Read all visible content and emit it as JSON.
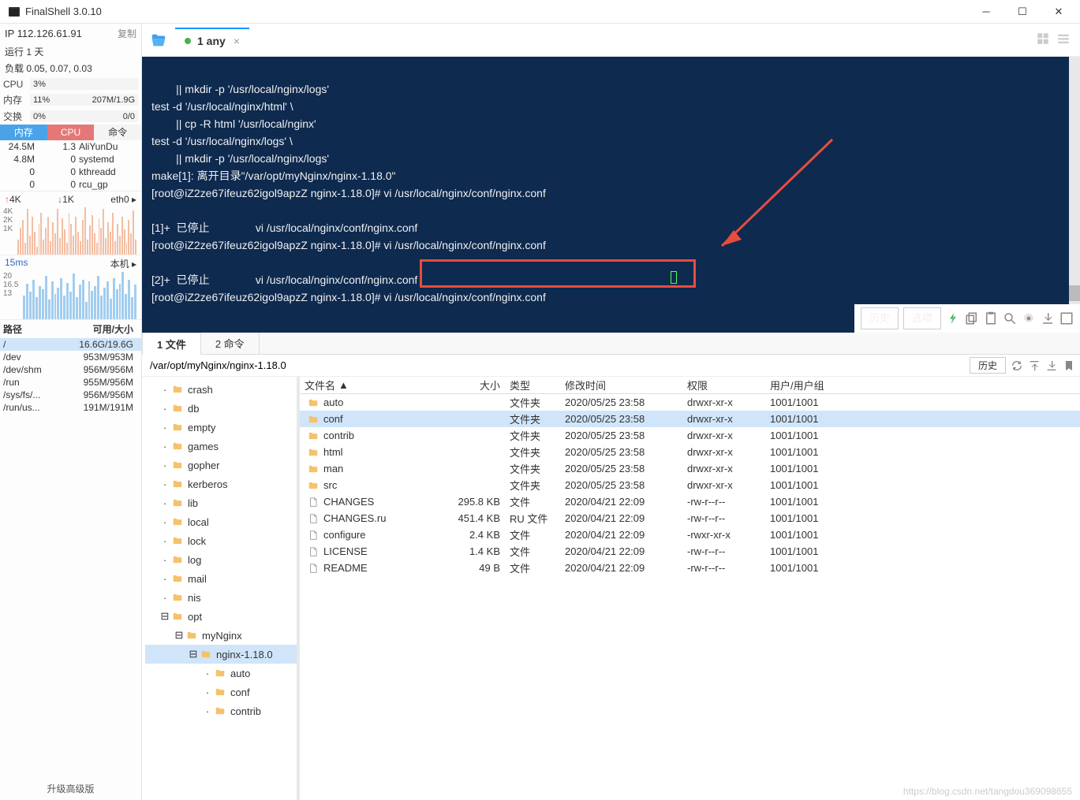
{
  "window": {
    "title": "FinalShell 3.0.10"
  },
  "sidebar": {
    "ip": "IP 112.126.61.91",
    "copy_label": "复制",
    "uptime": "运行 1 天",
    "load": "负载 0.05, 0.07, 0.03",
    "cpu_label": "CPU",
    "cpu_val": "3%",
    "mem_label": "内存",
    "mem_val": "11%",
    "mem_detail": "207M/1.9G",
    "swap_label": "交换",
    "swap_val": "0%",
    "swap_detail": "0/0",
    "tabs": {
      "mem": "内存",
      "cpu": "CPU",
      "cmd": "命令"
    },
    "procs": [
      {
        "mem": "24.5M",
        "cpu": "1.3",
        "name": "AliYunDu"
      },
      {
        "mem": "4.8M",
        "cpu": "0",
        "name": "systemd"
      },
      {
        "mem": "0",
        "cpu": "0",
        "name": "kthreadd"
      },
      {
        "mem": "0",
        "cpu": "0",
        "name": "rcu_gp"
      }
    ],
    "net_up": "4K",
    "net_dn": "1K",
    "net_if": "eth0",
    "net_ticks": [
      "4K",
      "2K",
      "1K"
    ],
    "ping": "15ms",
    "ping_label": "本机",
    "ping_ticks": [
      "20",
      "16.5",
      "13"
    ],
    "disk_hdr_path": "路径",
    "disk_hdr_usage": "可用/大小",
    "disks": [
      {
        "path": "/",
        "usage": "16.6G/19.6G",
        "sel": true
      },
      {
        "path": "/dev",
        "usage": "953M/953M"
      },
      {
        "path": "/dev/shm",
        "usage": "956M/956M"
      },
      {
        "path": "/run",
        "usage": "955M/956M"
      },
      {
        "path": "/sys/fs/...",
        "usage": "956M/956M"
      },
      {
        "path": "/run/us...",
        "usage": "191M/191M"
      }
    ],
    "upgrade": "升级高级版"
  },
  "tab": {
    "label": "1 any"
  },
  "terminal_lines": [
    "        || mkdir -p '/usr/local/nginx/logs'",
    "test -d '/usr/local/nginx/html' \\",
    "        || cp -R html '/usr/local/nginx'",
    "test -d '/usr/local/nginx/logs' \\",
    "        || mkdir -p '/usr/local/nginx/logs'",
    "make[1]: 离开目录\"/var/opt/myNginx/nginx-1.18.0\"",
    "[root@iZ2ze67ifeuz62igol9apzZ nginx-1.18.0]# vi /usr/local/nginx/conf/nginx.conf",
    "",
    "[1]+  已停止               vi /usr/local/nginx/conf/nginx.conf",
    "[root@iZ2ze67ifeuz62igol9apzZ nginx-1.18.0]# vi /usr/local/nginx/conf/nginx.conf",
    "",
    "[2]+  已停止               vi /usr/local/nginx/conf/nginx.conf",
    "[root@iZ2ze67ifeuz62igol9apzZ nginx-1.18.0]# vi /usr/local/nginx/conf/nginx.conf"
  ],
  "term_toolbar": {
    "history": "历史",
    "options": "选项"
  },
  "filetabs": {
    "files": "1 文件",
    "cmds": "2 命令"
  },
  "path_value": "/var/opt/myNginx/nginx-1.18.0",
  "path_history": "历史",
  "tree": [
    {
      "depth": 1,
      "name": "crash"
    },
    {
      "depth": 1,
      "name": "db"
    },
    {
      "depth": 1,
      "name": "empty"
    },
    {
      "depth": 1,
      "name": "games"
    },
    {
      "depth": 1,
      "name": "gopher"
    },
    {
      "depth": 1,
      "name": "kerberos"
    },
    {
      "depth": 1,
      "name": "lib"
    },
    {
      "depth": 1,
      "name": "local"
    },
    {
      "depth": 1,
      "name": "lock"
    },
    {
      "depth": 1,
      "name": "log"
    },
    {
      "depth": 1,
      "name": "mail"
    },
    {
      "depth": 1,
      "name": "nis"
    },
    {
      "depth": 1,
      "name": "opt",
      "exp": true
    },
    {
      "depth": 2,
      "name": "myNginx",
      "exp": true
    },
    {
      "depth": 3,
      "name": "nginx-1.18.0",
      "exp": true,
      "sel": true
    },
    {
      "depth": 4,
      "name": "auto"
    },
    {
      "depth": 4,
      "name": "conf"
    },
    {
      "depth": 4,
      "name": "contrib"
    }
  ],
  "file_hdr": {
    "name": "文件名",
    "size": "大小",
    "type": "类型",
    "time": "修改时间",
    "perm": "权限",
    "user": "用户/用户组"
  },
  "files": [
    {
      "icon": "folder",
      "name": "auto",
      "size": "",
      "type": "文件夹",
      "time": "2020/05/25 23:58",
      "perm": "drwxr-xr-x",
      "user": "1001/1001"
    },
    {
      "icon": "folder",
      "name": "conf",
      "size": "",
      "type": "文件夹",
      "time": "2020/05/25 23:58",
      "perm": "drwxr-xr-x",
      "user": "1001/1001",
      "sel": true
    },
    {
      "icon": "folder",
      "name": "contrib",
      "size": "",
      "type": "文件夹",
      "time": "2020/05/25 23:58",
      "perm": "drwxr-xr-x",
      "user": "1001/1001"
    },
    {
      "icon": "folder",
      "name": "html",
      "size": "",
      "type": "文件夹",
      "time": "2020/05/25 23:58",
      "perm": "drwxr-xr-x",
      "user": "1001/1001"
    },
    {
      "icon": "folder",
      "name": "man",
      "size": "",
      "type": "文件夹",
      "time": "2020/05/25 23:58",
      "perm": "drwxr-xr-x",
      "user": "1001/1001"
    },
    {
      "icon": "folder",
      "name": "src",
      "size": "",
      "type": "文件夹",
      "time": "2020/05/25 23:58",
      "perm": "drwxr-xr-x",
      "user": "1001/1001"
    },
    {
      "icon": "file",
      "name": "CHANGES",
      "size": "295.8 KB",
      "type": "文件",
      "time": "2020/04/21 22:09",
      "perm": "-rw-r--r--",
      "user": "1001/1001"
    },
    {
      "icon": "file",
      "name": "CHANGES.ru",
      "size": "451.4 KB",
      "type": "RU 文件",
      "time": "2020/04/21 22:09",
      "perm": "-rw-r--r--",
      "user": "1001/1001"
    },
    {
      "icon": "file",
      "name": "configure",
      "size": "2.4 KB",
      "type": "文件",
      "time": "2020/04/21 22:09",
      "perm": "-rwxr-xr-x",
      "user": "1001/1001"
    },
    {
      "icon": "file",
      "name": "LICENSE",
      "size": "1.4 KB",
      "type": "文件",
      "time": "2020/04/21 22:09",
      "perm": "-rw-r--r--",
      "user": "1001/1001"
    },
    {
      "icon": "file",
      "name": "README",
      "size": "49 B",
      "type": "文件",
      "time": "2020/04/21 22:09",
      "perm": "-rw-r--r--",
      "user": "1001/1001"
    }
  ],
  "watermark": "https://blog.csdn.net/tangdou369098655",
  "spark_net": [
    20,
    35,
    45,
    15,
    60,
    25,
    50,
    30,
    10,
    40,
    55,
    20,
    35,
    50,
    18,
    42,
    28,
    60,
    22,
    48,
    33,
    15,
    55,
    40,
    25,
    50,
    30,
    18,
    45,
    62,
    20,
    38,
    52,
    28,
    15,
    48,
    35,
    60,
    22,
    42,
    30,
    55,
    18,
    40,
    25,
    50,
    33,
    15,
    45,
    28,
    58,
    20
  ],
  "spark_ping": [
    30,
    45,
    35,
    50,
    28,
    42,
    38,
    55,
    25,
    48,
    32,
    40,
    52,
    30,
    46,
    35,
    58,
    28,
    44,
    50,
    22,
    48,
    36,
    42,
    55,
    30,
    40,
    48,
    26,
    52,
    38,
    45,
    60,
    32,
    50,
    28,
    44
  ]
}
